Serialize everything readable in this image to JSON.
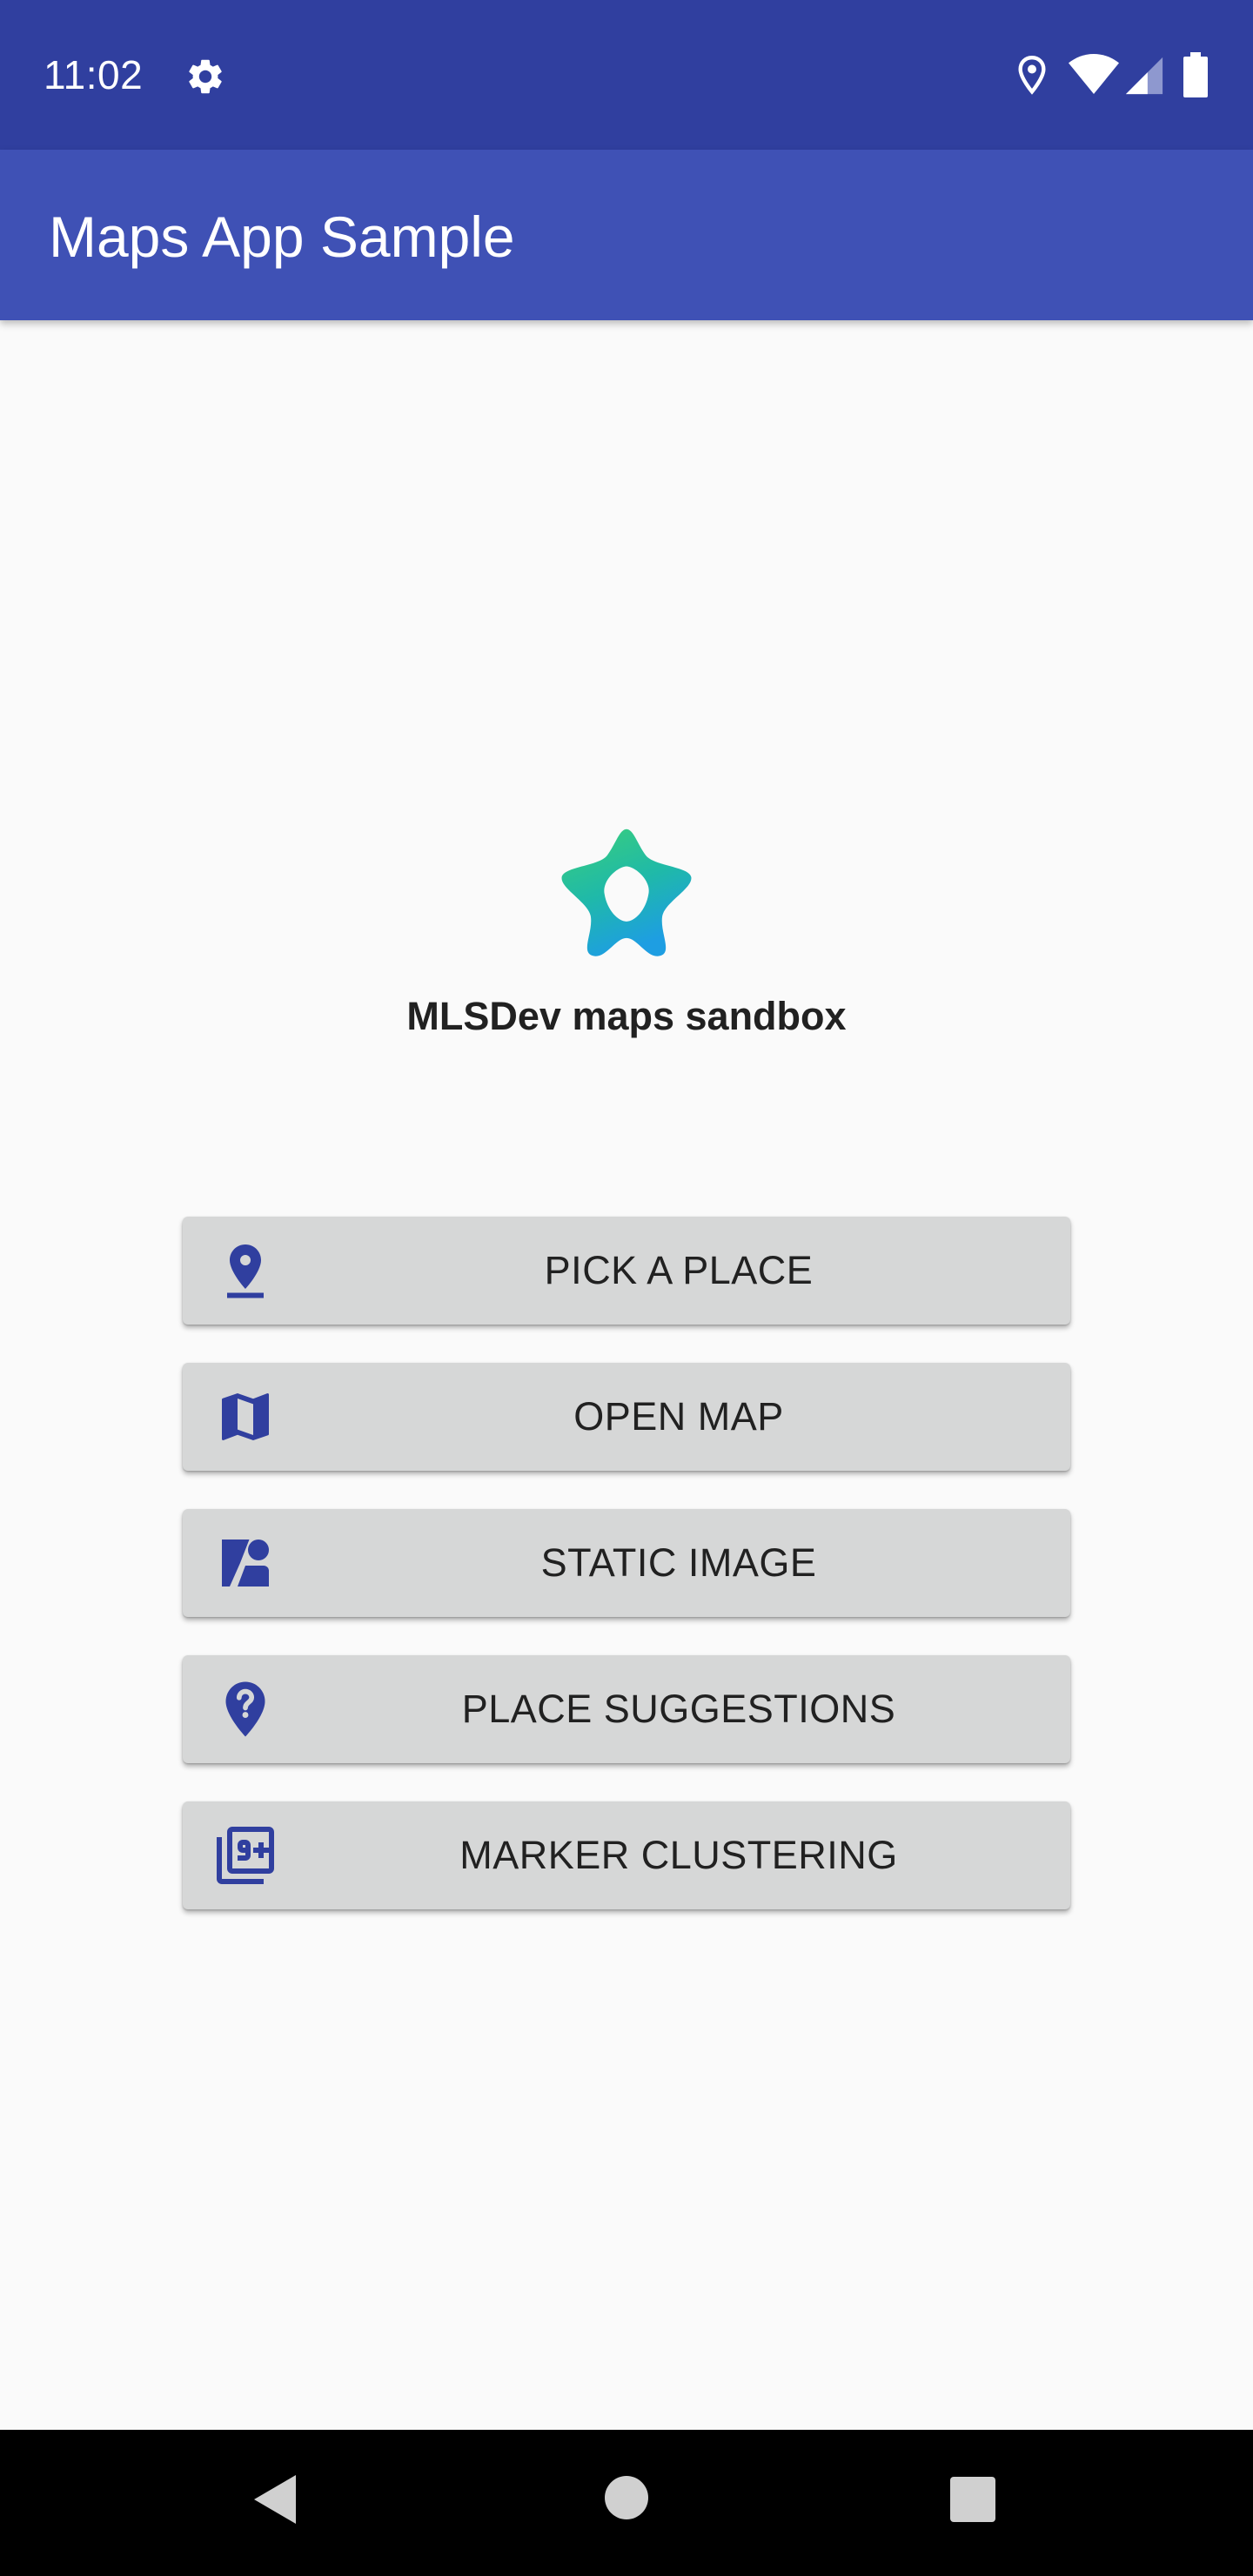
{
  "status_bar": {
    "time": "11:02",
    "icons": [
      "gear-icon",
      "location-icon",
      "wifi-icon",
      "cell-signal-icon",
      "battery-icon"
    ],
    "background": "#303f9f"
  },
  "app_bar": {
    "title": "Maps App Sample",
    "background": "#3f51b5"
  },
  "main": {
    "logo_icon": "mlsdev-star-logo",
    "subtitle": "MLSDev maps sandbox",
    "buttons": [
      {
        "label": "PICK A PLACE",
        "icon": "pin-drop-icon"
      },
      {
        "label": "OPEN MAP",
        "icon": "map-icon"
      },
      {
        "label": "STATIC IMAGE",
        "icon": "static-image-icon"
      },
      {
        "label": "PLACE SUGGESTIONS",
        "icon": "question-pin-icon"
      },
      {
        "label": "MARKER CLUSTERING",
        "icon": "filter-9-plus-icon"
      }
    ],
    "icon_color": "#303f9f",
    "button_color": "#d6d7d7"
  },
  "nav_bar": {
    "buttons": [
      "back-icon",
      "home-icon",
      "recents-icon"
    ]
  }
}
